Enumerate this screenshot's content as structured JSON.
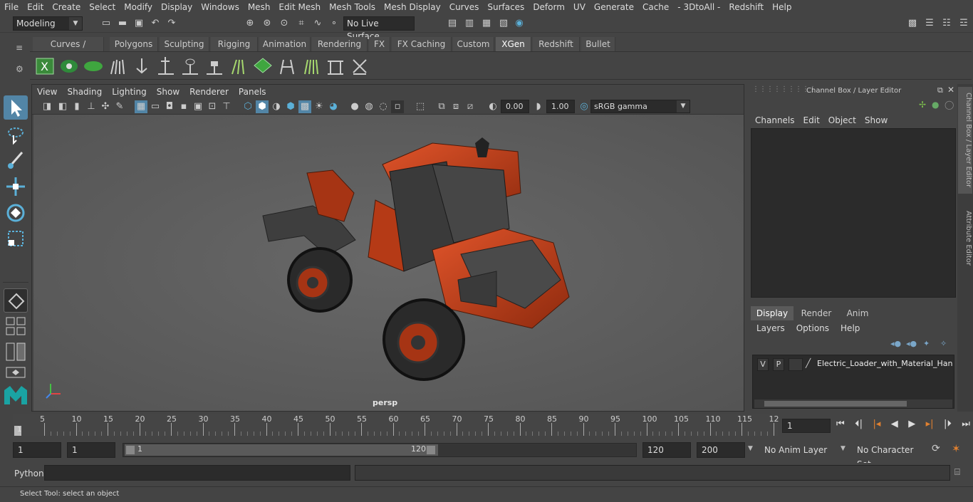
{
  "menubar": {
    "items": [
      "File",
      "Edit",
      "Create",
      "Select",
      "Modify",
      "Display",
      "Windows",
      "Mesh",
      "Edit Mesh",
      "Mesh Tools",
      "Mesh Display",
      "Curves",
      "Surfaces",
      "Deform",
      "UV",
      "Generate",
      "Cache",
      "- 3DtoAll -",
      "Redshift",
      "Help"
    ]
  },
  "statusline": {
    "mode": "Modeling",
    "live_surface": "No Live Surface"
  },
  "shelf": {
    "tabs": [
      "Curves / Surfaces",
      "Polygons",
      "Sculpting",
      "Rigging",
      "Animation",
      "Rendering",
      "FX",
      "FX Caching",
      "Custom",
      "XGen",
      "Redshift",
      "Bullet"
    ],
    "active_tab": "XGen"
  },
  "viewport": {
    "menu": [
      "View",
      "Shading",
      "Lighting",
      "Show",
      "Renderer",
      "Panels"
    ],
    "exposure": "0.00",
    "gamma": "1.00",
    "color_space": "sRGB gamma",
    "camera": "persp"
  },
  "channelbox": {
    "title": "Channel Box / Layer Editor",
    "menu": [
      "Channels",
      "Edit",
      "Object",
      "Show"
    ],
    "layer_tabs": [
      "Display",
      "Render",
      "Anim"
    ],
    "active_layer_tab": "Display",
    "layer_menu": [
      "Layers",
      "Options",
      "Help"
    ],
    "layer": {
      "v": "V",
      "p": "P",
      "name": "Electric_Loader_with_Material_Handli"
    }
  },
  "side_tabs": {
    "channel_box": "Channel Box / Layer Editor",
    "attribute_editor": "Attribute Editor"
  },
  "timeline": {
    "ticks": [
      "5",
      "10",
      "15",
      "20",
      "25",
      "30",
      "35",
      "40",
      "45",
      "50",
      "55",
      "60",
      "65",
      "70",
      "75",
      "80",
      "85",
      "90",
      "95",
      "100",
      "105",
      "110",
      "115",
      "12"
    ],
    "start_marker": "1",
    "current_frame": "1"
  },
  "range": {
    "start": "1",
    "playback_start": "1",
    "slider_start": "1",
    "slider_end": "120",
    "playback_end": "120",
    "end": "200",
    "anim_layer": "No Anim Layer",
    "character_set": "No Character Set"
  },
  "cmdline": {
    "label": "Python"
  },
  "helpline": {
    "text": "Select Tool: select an object"
  },
  "colors": {
    "accent": "#5285a6",
    "loader_body": "#c8401a",
    "shelf_green": "#3fa63f"
  }
}
